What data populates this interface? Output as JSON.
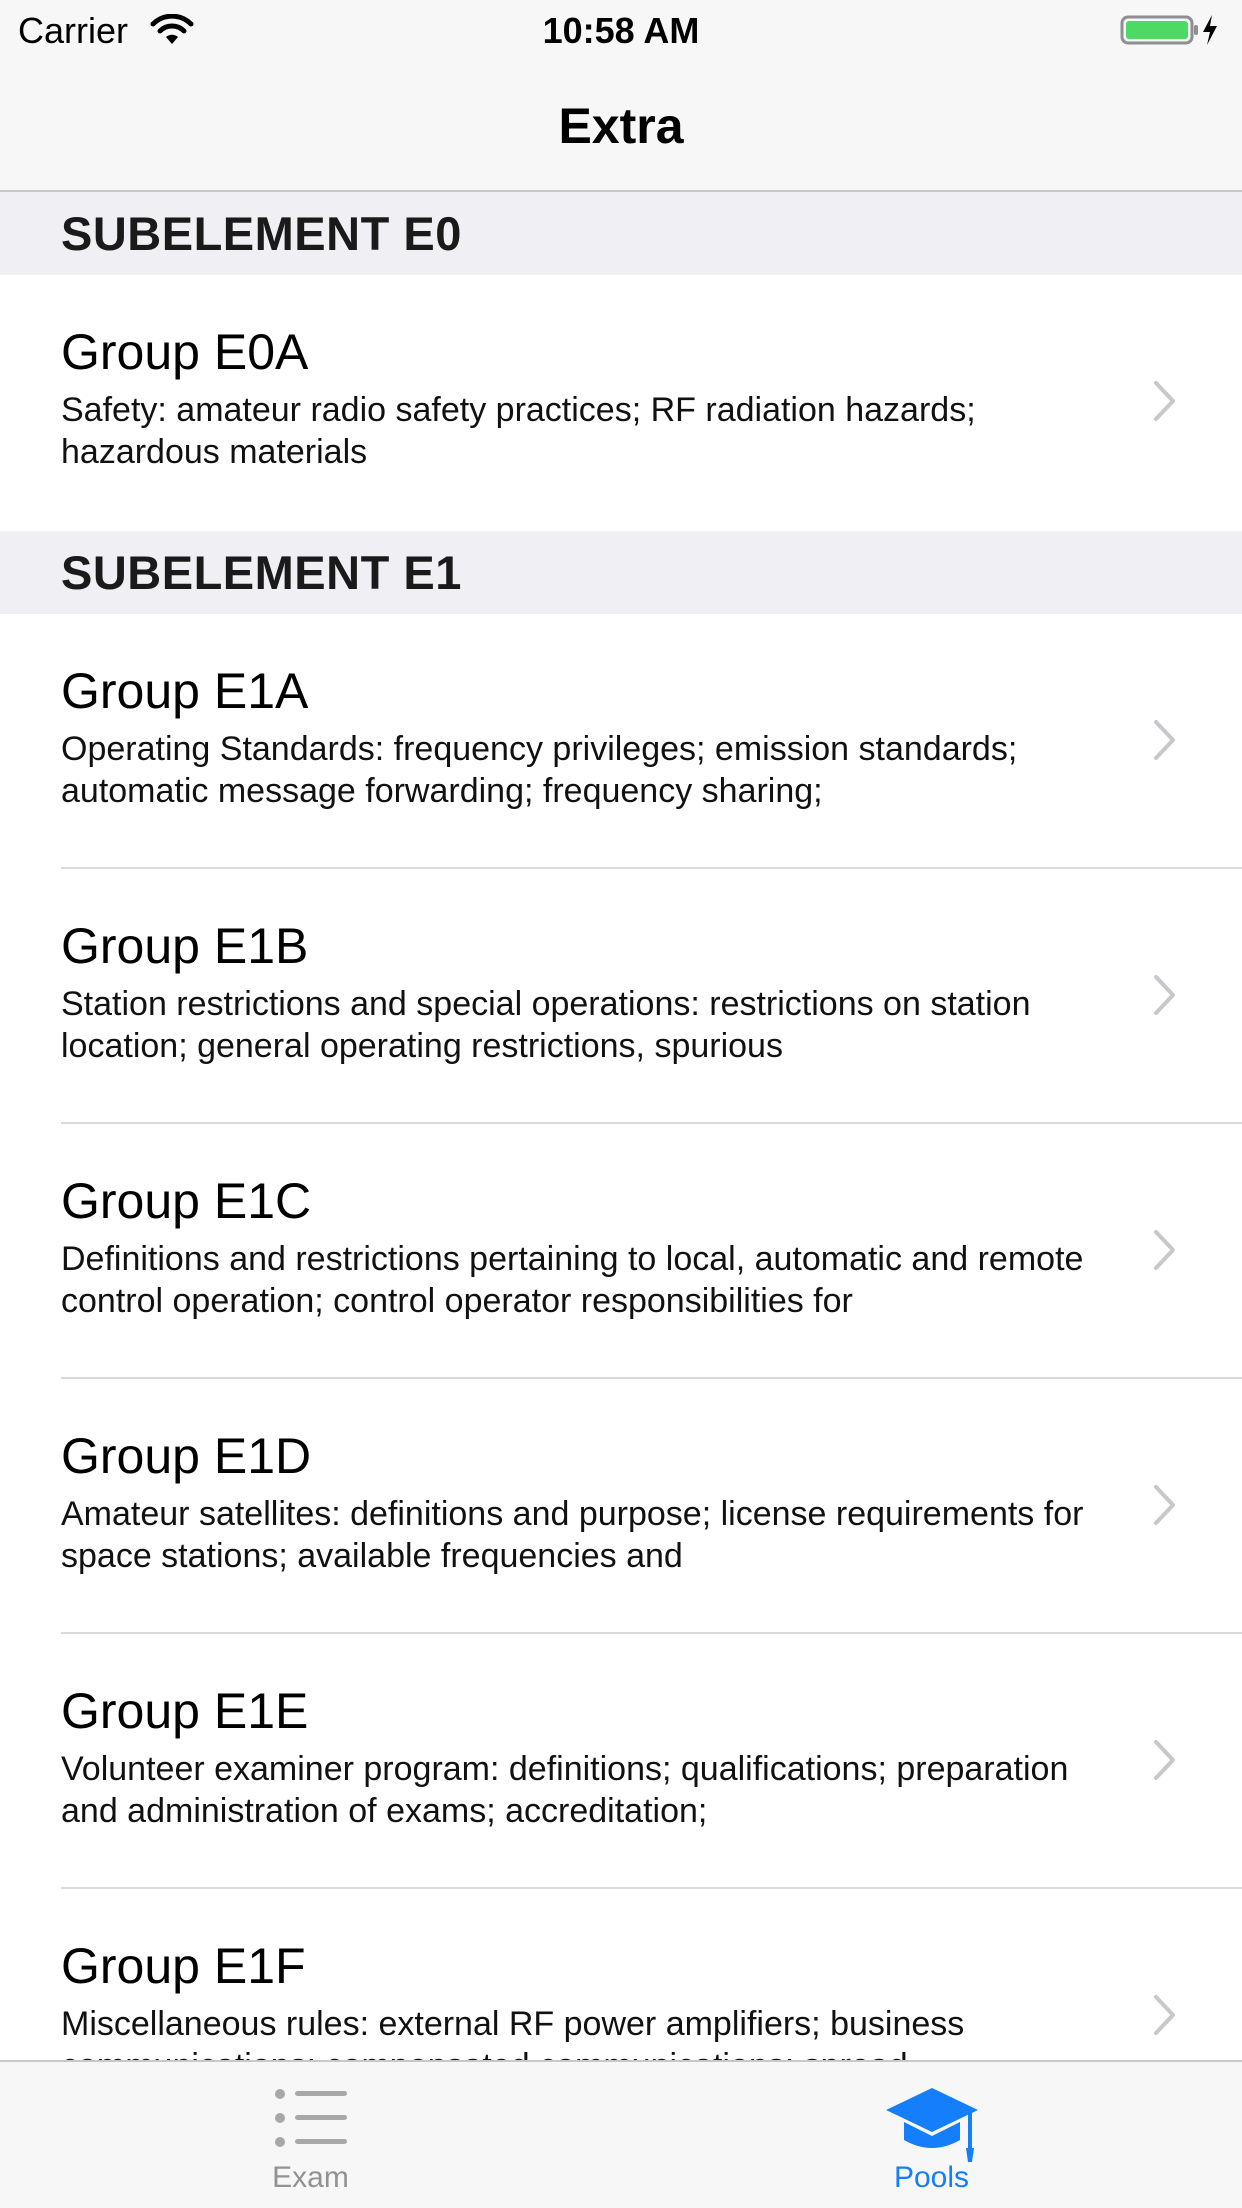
{
  "status_bar": {
    "carrier": "Carrier",
    "time": "10:58 AM",
    "battery_color": "#4cd964"
  },
  "nav": {
    "title": "Extra"
  },
  "sections": [
    {
      "header": "SUBELEMENT E0",
      "rows": [
        {
          "title": "Group E0A",
          "subtitle": "Safety: amateur radio safety practices; RF radiation hazards; hazardous materials"
        }
      ]
    },
    {
      "header": "SUBELEMENT E1",
      "rows": [
        {
          "title": "Group E1A",
          "subtitle": "Operating Standards: frequency privileges; emission standards; automatic message forwarding; frequency sharing;"
        },
        {
          "title": "Group E1B",
          "subtitle": "Station restrictions and special operations: restrictions on station location; general operating restrictions, spurious"
        },
        {
          "title": "Group E1C",
          "subtitle": "Definitions and restrictions pertaining to local, automatic and remote control operation; control operator responsibilities for"
        },
        {
          "title": "Group E1D",
          "subtitle": "Amateur satellites: definitions and purpose; license requirements for space stations; available frequencies and"
        },
        {
          "title": "Group E1E",
          "subtitle": "Volunteer examiner program: definitions; qualifications; preparation and administration of exams; accreditation;"
        },
        {
          "title": "Group E1F",
          "subtitle": "Miscellaneous rules: external RF power amplifiers; business communications; compensated communications; spread"
        }
      ]
    }
  ],
  "tab_bar": {
    "tabs": [
      {
        "label": "Exam",
        "icon": "list-icon",
        "selected": false
      },
      {
        "label": "Pools",
        "icon": "graduation-cap-icon",
        "selected": true
      }
    ],
    "active_color": "#147efb",
    "inactive_color": "#929292"
  }
}
